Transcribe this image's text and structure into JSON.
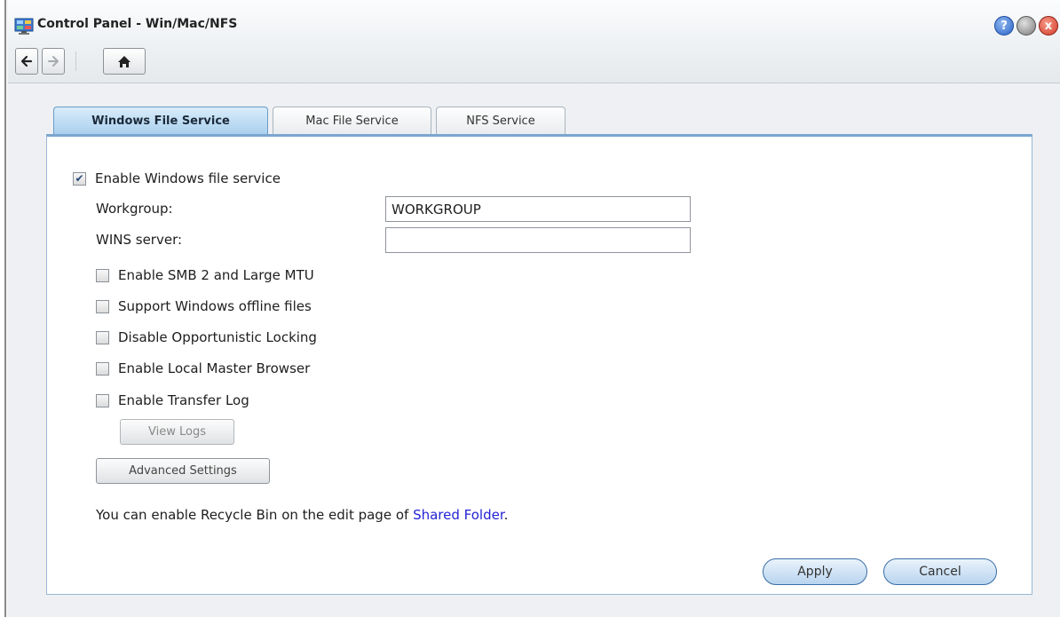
{
  "window": {
    "title": "Control Panel - Win/Mac/NFS",
    "app_icon": "control-panel-icon",
    "controls": {
      "help": "?",
      "minimize": "",
      "close": "x"
    }
  },
  "nav": {
    "back_icon": "arrow-left-icon",
    "forward_icon": "arrow-right-icon",
    "home_icon": "home-icon"
  },
  "tabs": [
    {
      "label": "Windows File Service",
      "active": true
    },
    {
      "label": "Mac File Service",
      "active": false
    },
    {
      "label": "NFS Service",
      "active": false
    }
  ],
  "form": {
    "enable_windows": {
      "label": "Enable Windows file service",
      "checked": true
    },
    "workgroup": {
      "label": "Workgroup:",
      "value": "WORKGROUP"
    },
    "wins": {
      "label": "WINS server:",
      "value": ""
    },
    "options": [
      {
        "label": "Enable SMB 2 and Large MTU",
        "checked": false
      },
      {
        "label": "Support Windows offline files",
        "checked": false
      },
      {
        "label": "Disable Opportunistic Locking",
        "checked": false
      },
      {
        "label": "Enable Local Master Browser",
        "checked": false
      },
      {
        "label": "Enable Transfer Log",
        "checked": false
      }
    ],
    "view_logs_label": "View Logs",
    "advanced_label": "Advanced Settings",
    "info_prefix": "You can enable Recycle Bin on the edit page of ",
    "info_link": "Shared Folder",
    "info_suffix": "."
  },
  "footer": {
    "apply_label": "Apply",
    "cancel_label": "Cancel"
  },
  "colors": {
    "accent": "#7aa6cf",
    "link": "#2323d6",
    "tab_active": "#a9cfee"
  }
}
